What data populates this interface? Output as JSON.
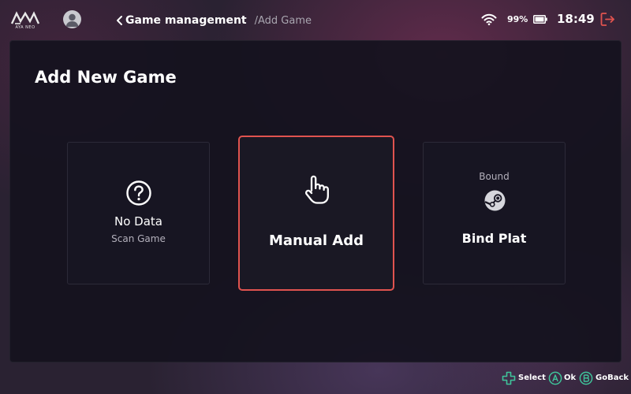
{
  "brand": {
    "logo_text": "AYA NEO"
  },
  "breadcrumb": {
    "back_icon": "chevron-left-icon",
    "current": "Game management",
    "sub": "/Add Game"
  },
  "status": {
    "wifi_icon": "wifi-icon",
    "battery_percent": "99%",
    "battery_icon": "battery-icon",
    "time": "18:49",
    "exit_icon": "exit-icon",
    "exit_color": "#e0534f"
  },
  "page": {
    "title": "Add New Game"
  },
  "cards": {
    "no_data": {
      "icon": "question-circle-icon",
      "title": "No Data",
      "subtitle": "Scan Game"
    },
    "manual_add": {
      "icon": "hand-pointer-icon",
      "title": "Manual Add",
      "selected": true,
      "highlight_color": "#e0534f"
    },
    "bind_plat": {
      "status": "Bound",
      "icon": "steam-icon",
      "title": "Bind Plat"
    }
  },
  "hints": {
    "select": {
      "icon": "dpad-icon",
      "label": "Select",
      "color": "#3fc39a"
    },
    "ok": {
      "icon": "a-button-icon",
      "label": "Ok",
      "color": "#3fc39a"
    },
    "goback": {
      "icon": "b-button-icon",
      "label": "GoBack",
      "color": "#3fc39a"
    }
  }
}
